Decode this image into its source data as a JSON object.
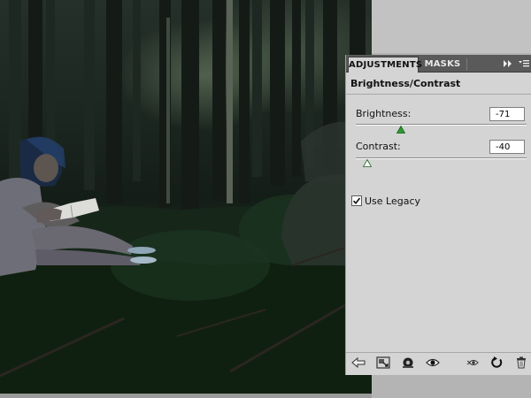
{
  "panel": {
    "tabs": [
      {
        "label": "ADJUSTMENTS",
        "active": true
      },
      {
        "label": "MASKS",
        "active": false
      }
    ],
    "collapse_icon": "double-chevron-right-icon",
    "menu_icon": "panel-menu-icon",
    "title": "Brightness/Contrast",
    "controls": {
      "brightness": {
        "label": "Brightness:",
        "value": "-71",
        "min": -150,
        "max": 150
      },
      "contrast": {
        "label": "Contrast:",
        "value": "-40",
        "min": -50,
        "max": 100
      }
    },
    "use_legacy": {
      "label": "Use Legacy",
      "checked": true
    },
    "footer_icons": [
      "back-arrow-icon",
      "expanded-view-icon",
      "clip-to-layer-icon",
      "eye-icon",
      "view-previous-state-icon",
      "reset-icon",
      "trash-icon"
    ]
  },
  "colors": {
    "panel_bg": "#d4d4d4",
    "tab_bar": "#5a5a5a",
    "slider_thumb": "#2e9a2e"
  }
}
